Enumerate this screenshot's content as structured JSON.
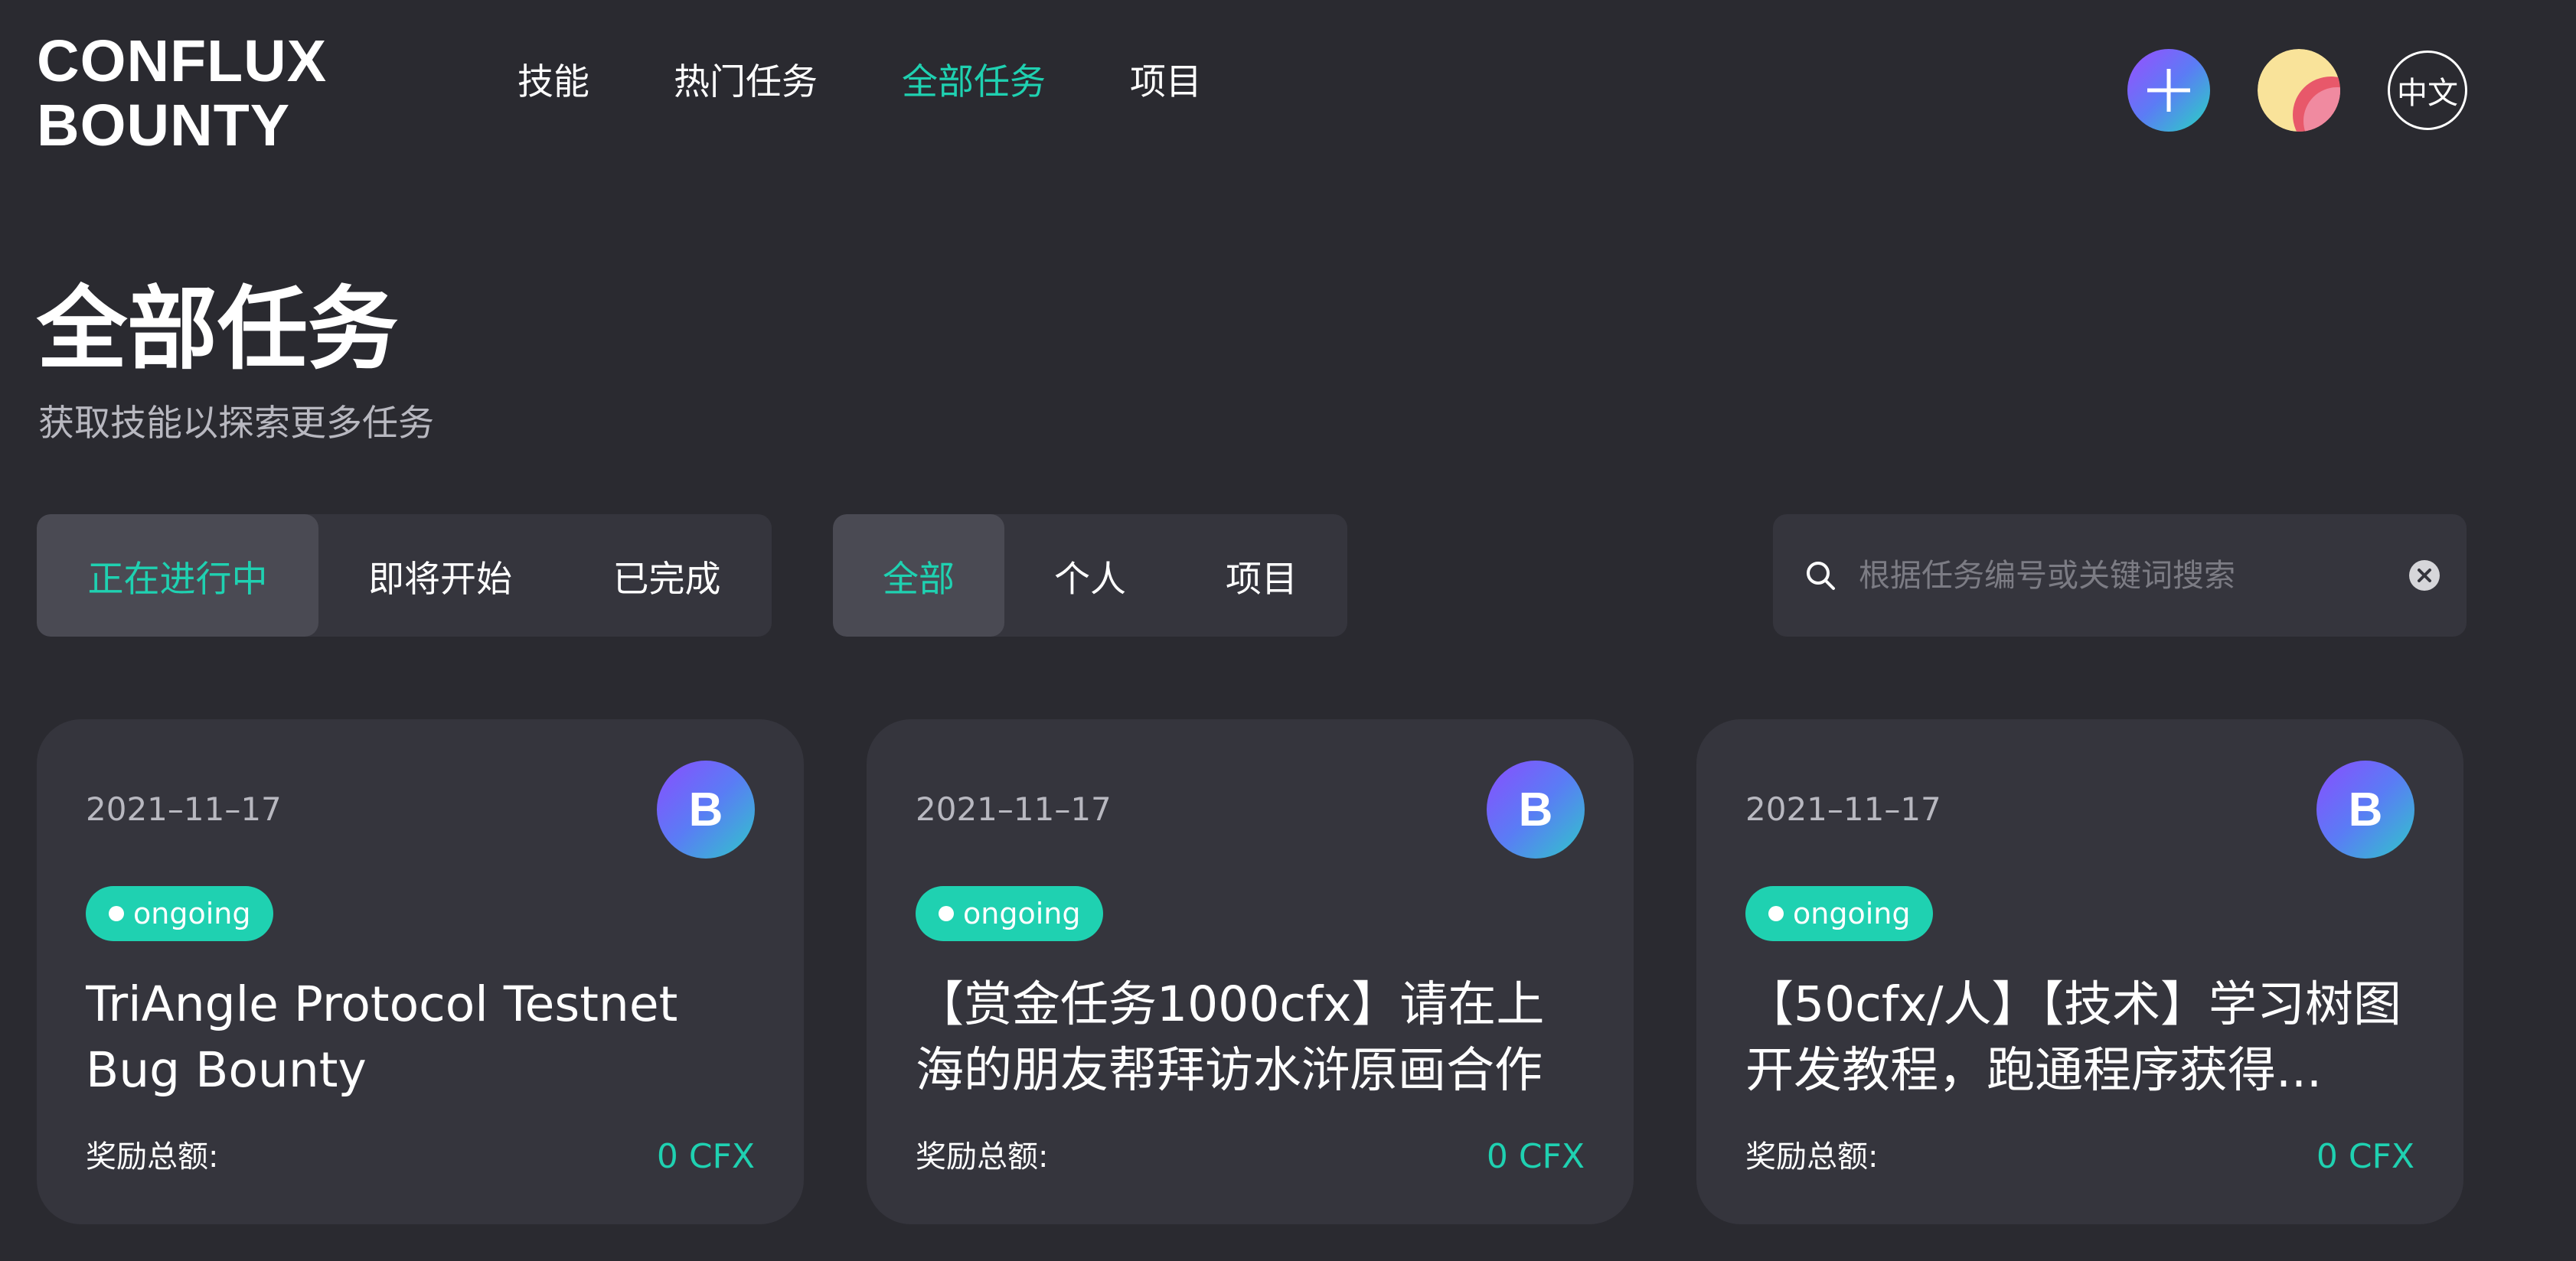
{
  "brand": {
    "line1": "CONFLUX",
    "line2": "BOUNTY"
  },
  "nav": {
    "items": [
      {
        "label": "技能",
        "active": false
      },
      {
        "label": "热门任务",
        "active": false
      },
      {
        "label": "全部任务",
        "active": true
      },
      {
        "label": "项目",
        "active": false
      }
    ]
  },
  "header": {
    "lang_label": "中文"
  },
  "page": {
    "title": "全部任务",
    "subtitle": "获取技能以探索更多任务"
  },
  "status_filter": {
    "items": [
      {
        "label": "正在进行中",
        "active": true
      },
      {
        "label": "即将开始",
        "active": false
      },
      {
        "label": "已完成",
        "active": false
      }
    ]
  },
  "type_filter": {
    "items": [
      {
        "label": "全部",
        "active": true
      },
      {
        "label": "个人",
        "active": false
      },
      {
        "label": "项目",
        "active": false
      }
    ]
  },
  "search": {
    "placeholder": "根据任务编号或关键词搜索",
    "value": ""
  },
  "cards": [
    {
      "date": "2021–11–17",
      "badge": "B",
      "status": "ongoing",
      "title": "TriAngle Protocol Testnet Bug Bounty",
      "reward_label": "奖励总额:",
      "reward_value": "0 CFX"
    },
    {
      "date": "2021–11–17",
      "badge": "B",
      "status": "ongoing",
      "title": "【赏金任务1000cfx】请在上海的朋友帮拜访水浒原画合作",
      "reward_label": "奖励总额:",
      "reward_value": "0 CFX"
    },
    {
      "date": "2021–11–17",
      "badge": "B",
      "status": "ongoing",
      "title": "【50cfx/人】【技术】学习树图开发教程，跑通程序获得...",
      "reward_label": "奖励总额:",
      "reward_value": "0 CFX"
    }
  ],
  "colors": {
    "background": "#2a2a30",
    "panel": "#35353d",
    "accent": "#1fd1b1",
    "muted_text": "#b8b8c0"
  },
  "icons": {
    "create": "plus-icon",
    "search": "search-icon",
    "clear": "clear-icon",
    "user": "user-avatar"
  }
}
